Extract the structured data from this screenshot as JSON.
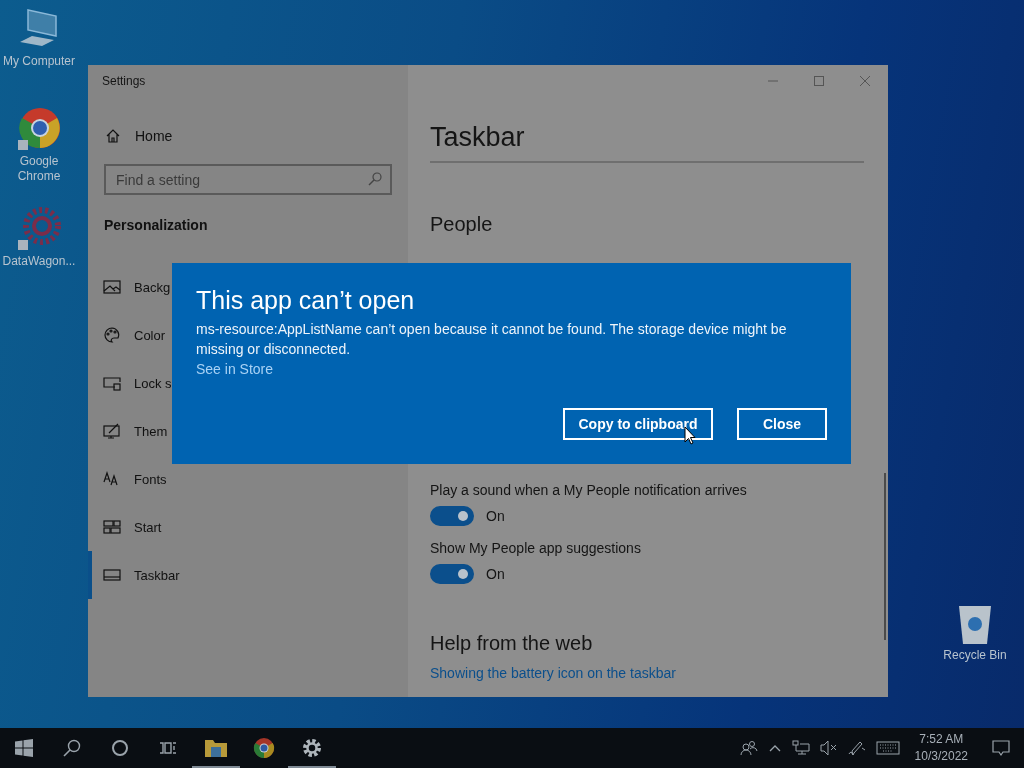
{
  "desktop_icons": [
    {
      "label": "My Computer"
    },
    {
      "label": "Google Chrome"
    },
    {
      "label": "DataWagon..."
    },
    {
      "label": "Recycle Bin"
    }
  ],
  "settings_window": {
    "title": "Settings",
    "sidebar": {
      "home": "Home",
      "search": {
        "placeholder": "Find a setting"
      },
      "section": "Personalization",
      "items": [
        {
          "label": "Backg",
          "selected": false
        },
        {
          "label": "Color",
          "selected": false
        },
        {
          "label": "Lock s",
          "selected": false
        },
        {
          "label": "Them",
          "selected": false
        },
        {
          "label": "Fonts",
          "selected": false
        },
        {
          "label": "Start",
          "selected": false
        },
        {
          "label": "Taskbar",
          "selected": true
        }
      ]
    },
    "page": {
      "title": "Taskbar",
      "section": "People",
      "toggles": [
        {
          "label": "Play a sound when a My People notification arrives",
          "on": true,
          "state_text": "On"
        },
        {
          "label": "Show My People app suggestions",
          "on": true,
          "state_text": "On"
        }
      ],
      "help_heading": "Help from the web",
      "help_link": "Showing the battery icon on the taskbar"
    }
  },
  "dialog": {
    "title": "This app can’t open",
    "message": "ms-resource:AppListName can’t open because it cannot be found. The storage device might be missing or disconnected.",
    "link": "See in Store",
    "buttons": [
      "Copy to clipboard",
      "Close"
    ]
  },
  "taskbar": {
    "apps": [
      {
        "running": true
      },
      {
        "running": false
      },
      {
        "running": true
      }
    ],
    "time": "7:52 AM",
    "date": "10/3/2022"
  }
}
